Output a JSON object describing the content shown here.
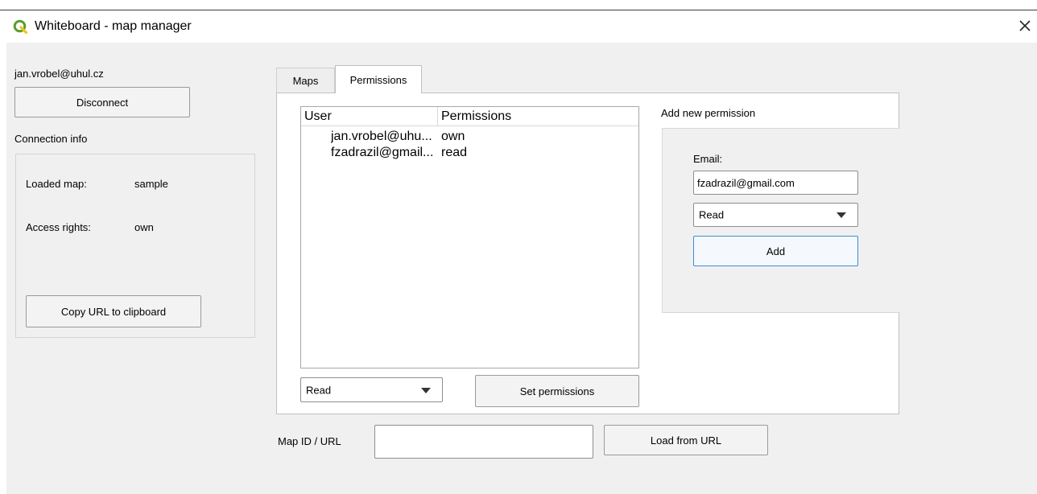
{
  "window": {
    "title": "Whiteboard - map manager",
    "close_icon": "close-icon",
    "app_icon": "qgis-logo-icon",
    "accent": "#5a9e2f"
  },
  "account": {
    "email": "jan.vrobel@uhul.cz",
    "disconnect_label": "Disconnect"
  },
  "connection": {
    "title": "Connection info",
    "loaded_map_label": "Loaded map:",
    "loaded_map_value": "sample",
    "access_rights_label": "Access rights:",
    "access_rights_value": "own",
    "copy_url_label": "Copy URL to clipboard"
  },
  "tabs": [
    {
      "label": "Maps",
      "active": false
    },
    {
      "label": "Permissions",
      "active": true
    }
  ],
  "permissions": {
    "columns": [
      "User",
      "Permissions"
    ],
    "rows": [
      {
        "user": "jan.vrobel@uhu...",
        "permission": "own"
      },
      {
        "user": "fzadrazil@gmail...",
        "permission": "read"
      }
    ],
    "selected_permission": "Read",
    "set_label": "Set permissions"
  },
  "add_permission": {
    "title": "Add new permission",
    "email_label": "Email:",
    "email_value": "fzadrazil@gmail.com",
    "permission_value": "Read",
    "add_label": "Add"
  },
  "load": {
    "label": "Map ID / URL",
    "input_value": "",
    "button_label": "Load from URL"
  }
}
